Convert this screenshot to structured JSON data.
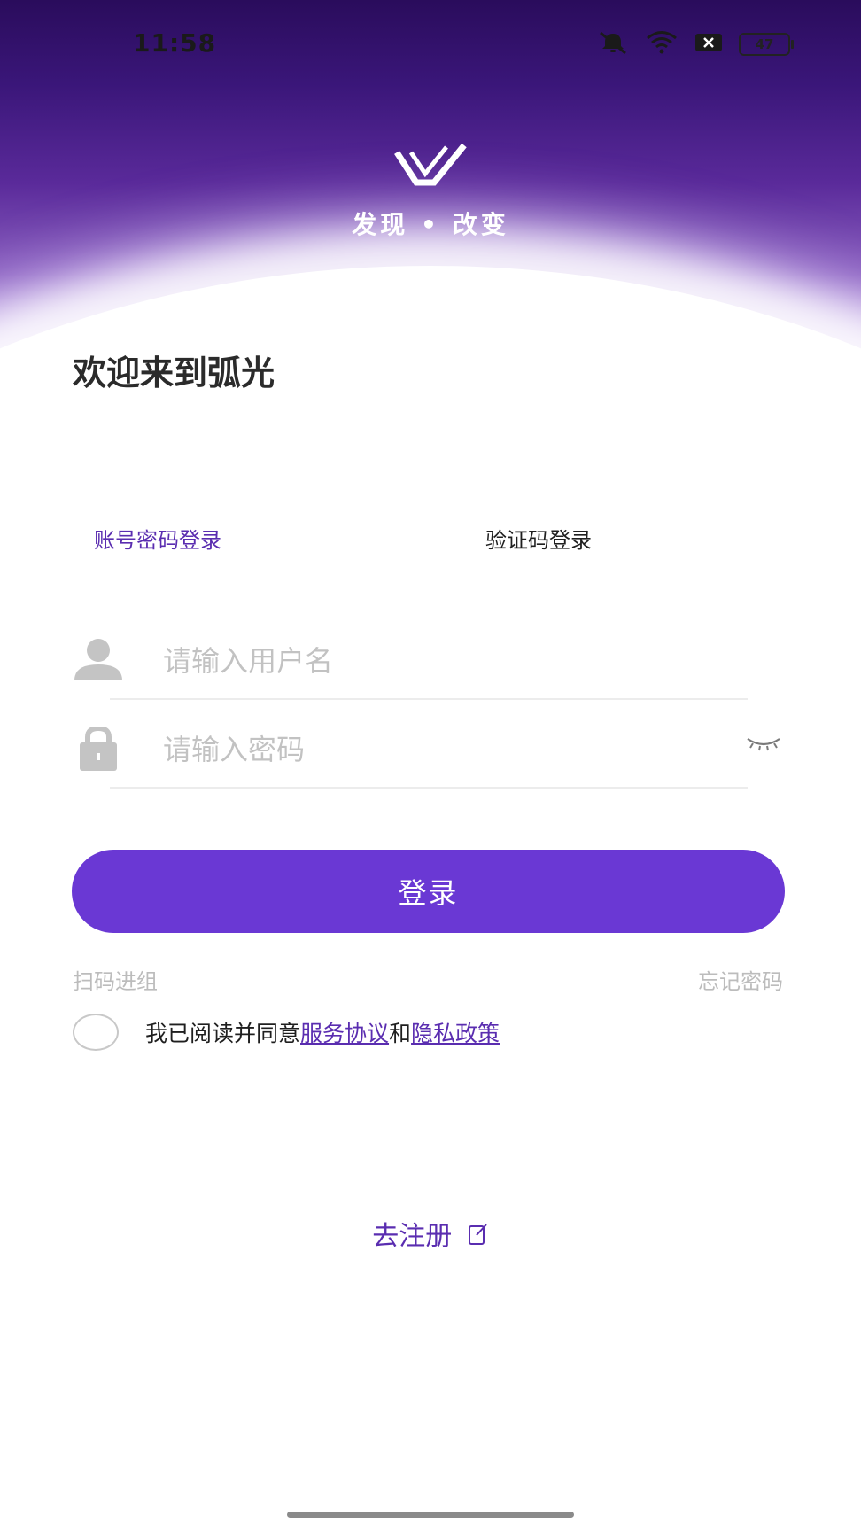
{
  "status_bar": {
    "time": "11:58",
    "battery": "47"
  },
  "brand": {
    "slogan": "发现 • 改变"
  },
  "welcome": "欢迎来到弧光",
  "tabs": [
    {
      "label": "账号密码登录",
      "active": true
    },
    {
      "label": "验证码登录",
      "active": false
    }
  ],
  "username": {
    "placeholder": "请输入用户名",
    "value": ""
  },
  "password": {
    "placeholder": "请输入密码",
    "value": ""
  },
  "login_button": "登录",
  "scan_link": "扫码进组",
  "forgot_link": "忘记密码",
  "agreement": {
    "checked": false,
    "prefix": "我已阅读并同意",
    "service_link": "服务协议",
    "and": "和",
    "privacy_link": "隐私政策"
  },
  "register_link": "去注册",
  "colors": {
    "accent": "#6a38d4",
    "link": "#5a2db0",
    "header_dark": "#2a0c5c"
  },
  "icons": [
    "mute-icon",
    "wifi-icon",
    "sim-off-icon",
    "battery-icon",
    "logo-icon",
    "user-icon",
    "lock-icon",
    "eye-closed-icon",
    "edit-icon"
  ]
}
